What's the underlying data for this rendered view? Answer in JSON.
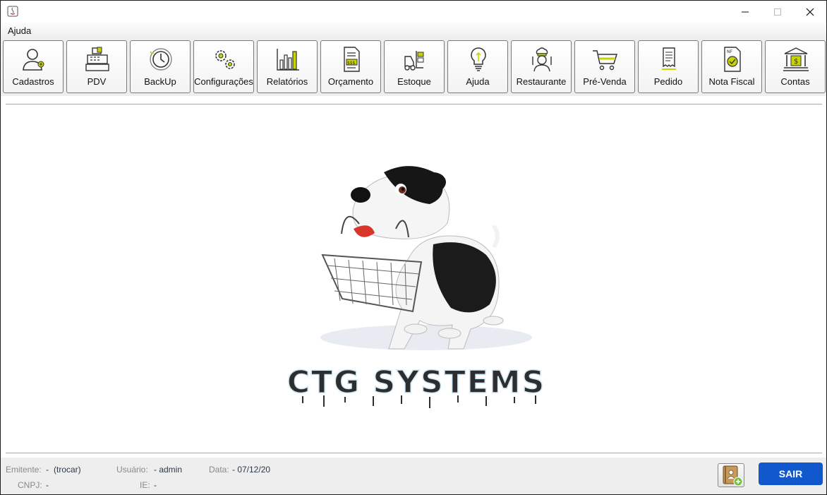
{
  "menu": {
    "items": [
      "Ajuda"
    ]
  },
  "toolbar": {
    "buttons": [
      {
        "label": "Cadastros",
        "icon": "user-add-icon"
      },
      {
        "label": "PDV",
        "icon": "cash-register-icon"
      },
      {
        "label": "BackUp",
        "icon": "clock-backup-icon"
      },
      {
        "label": "Configurações",
        "icon": "gears-icon"
      },
      {
        "label": "Relatórios",
        "icon": "bar-chart-icon"
      },
      {
        "label": "Orçamento",
        "icon": "budget-document-icon"
      },
      {
        "label": "Estoque",
        "icon": "forklift-icon"
      },
      {
        "label": "Ajuda",
        "icon": "lightbulb-icon"
      },
      {
        "label": "Restaurante",
        "icon": "chef-icon"
      },
      {
        "label": "Pré-Venda",
        "icon": "shopping-cart-icon"
      },
      {
        "label": "Pedido",
        "icon": "order-receipt-icon"
      },
      {
        "label": "Nota Fiscal",
        "icon": "invoice-icon"
      },
      {
        "label": "Contas",
        "icon": "bank-icon"
      }
    ]
  },
  "logo": {
    "text": "CTG SYSTEMS"
  },
  "status": {
    "emitente_label": "Emitente:",
    "emitente_value": "-",
    "trocar_link": "(trocar)",
    "usuario_label": "Usuário:",
    "usuario_value": "-  admin",
    "data_label": "Data:",
    "data_value": "-  07/12/20",
    "cnpj_label": "CNPJ:",
    "cnpj_value": "-",
    "ie_label": "IE:",
    "ie_value": "-"
  },
  "actions": {
    "exit_label": "SAIR"
  },
  "colors": {
    "accent": "#1058cc",
    "icon_highlight": "#c8d400"
  }
}
